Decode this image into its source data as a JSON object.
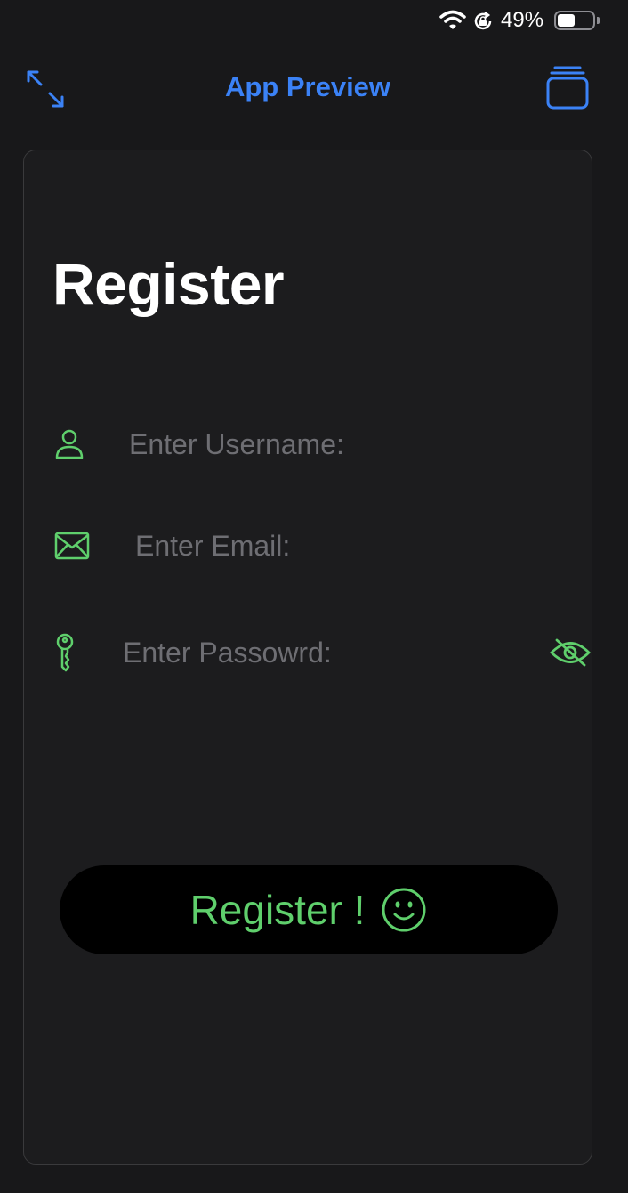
{
  "status_bar": {
    "battery_percent": "49%",
    "battery_level": 0.49
  },
  "nav": {
    "title": "App Preview"
  },
  "form": {
    "title": "Register",
    "username": {
      "placeholder": "Enter Username:",
      "value": ""
    },
    "email": {
      "placeholder": "Enter Email:",
      "value": ""
    },
    "password": {
      "placeholder": "Enter Passowrd:",
      "value": ""
    },
    "submit_label": "Register !"
  },
  "colors": {
    "accent_blue": "#3b82f6",
    "accent_green": "#5fcf6c",
    "background": "#18181a",
    "card": "#1c1c1e",
    "placeholder": "#6e6e73"
  },
  "icons": {
    "username": "person-icon",
    "email": "envelope-icon",
    "password": "key-icon",
    "visibility": "eye-slash-icon",
    "submit": "smiley-icon",
    "expand": "expand-arrows-icon",
    "stack": "stacked-windows-icon"
  }
}
